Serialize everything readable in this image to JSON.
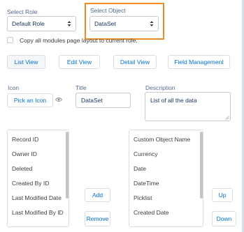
{
  "select_role": {
    "label": "Select Role",
    "value": "Default Role"
  },
  "select_object": {
    "label": "Select Object",
    "value": "DataSet"
  },
  "copy_checkbox": {
    "label": "Copy all modules page layout to current role.",
    "checked": false
  },
  "view_buttons": {
    "list_view": "List View",
    "edit_view": "Edit View",
    "detail_view": "Detail View",
    "field_management": "Field Management"
  },
  "icon_field": {
    "label": "Icon",
    "button": "Pick an Icon",
    "preview_icon": "eye-icon"
  },
  "title_field": {
    "label": "Title",
    "value": "DataSet"
  },
  "description_field": {
    "label": "Description",
    "value": "List of all the data"
  },
  "available_fields": [
    "Record ID",
    "Owner ID",
    "Deleted",
    "Created By ID",
    "Last Modified Date",
    "Last Modified By ID"
  ],
  "selected_fields": [
    "Custom Object Name",
    "Currency",
    "Date",
    "DateTime",
    "Picklist",
    "Created Date"
  ],
  "transfer_buttons": {
    "add": "Add",
    "remove": "Remove"
  },
  "order_buttons": {
    "up": "Up",
    "down": "Down"
  },
  "colors": {
    "highlight": "#f08a24",
    "link": "#0070d2",
    "label": "#54698d"
  }
}
